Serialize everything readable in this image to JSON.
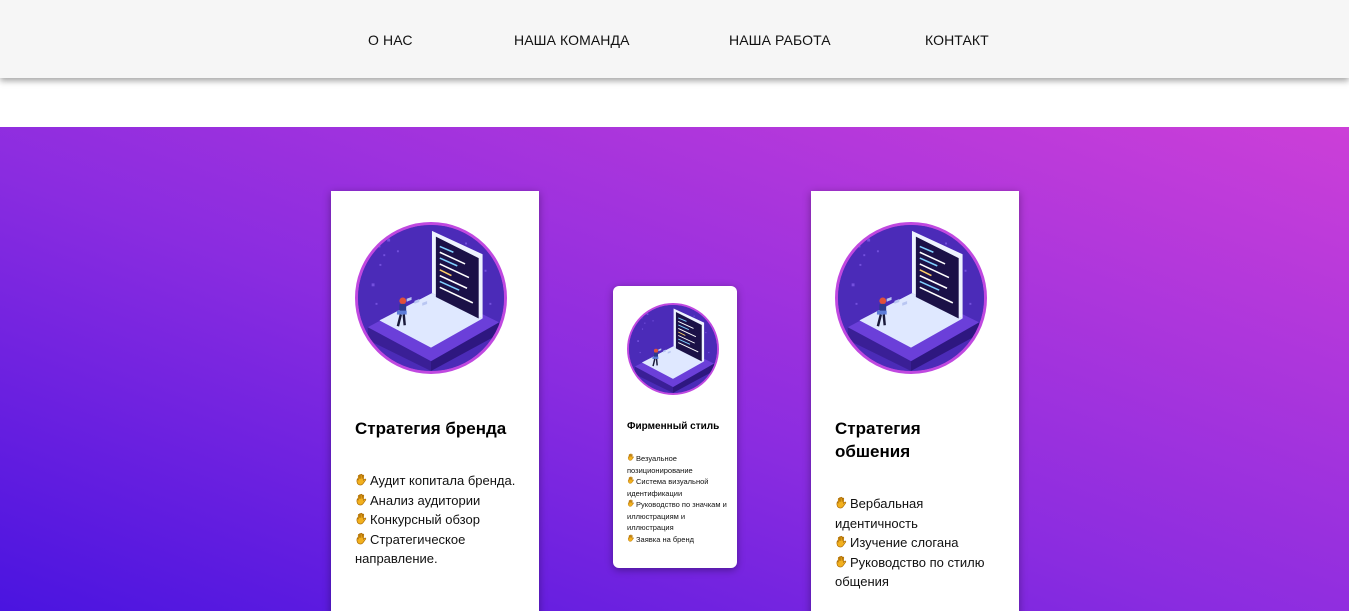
{
  "nav": {
    "items": [
      {
        "label": "О НАС"
      },
      {
        "label": "НАША КОМАНДА"
      },
      {
        "label": "НАША РАБОТА"
      },
      {
        "label": "КОНТАКТ"
      }
    ]
  },
  "cards": [
    {
      "title": "Стратегия бренда",
      "items": [
        "Аудит копитала бренда.",
        "Анализ аудитории",
        "Конкурсный обзор",
        "Стратегическое направление."
      ]
    },
    {
      "title": "Фирменный стиль",
      "items": [
        "Везуальное позиционирование",
        "Система визуальной идентификации",
        "Руководство по значкам и иллюстрациям и иллюстрация",
        "Заявка на бренд"
      ]
    },
    {
      "title": "Стратегия обшения",
      "items": [
        "Вербальная идентичность",
        "Изучение слогана",
        "Руководство по стилю общения"
      ]
    }
  ],
  "colors": {
    "gradient_start": "#4a14e0",
    "gradient_end": "#cc3fd8",
    "avatar_ring": "#c048e0",
    "nav_bg": "#f6f6f6"
  },
  "icons": {
    "list_bullet": "raised-hand-icon",
    "card_image": "laptop-developer-illustration"
  }
}
